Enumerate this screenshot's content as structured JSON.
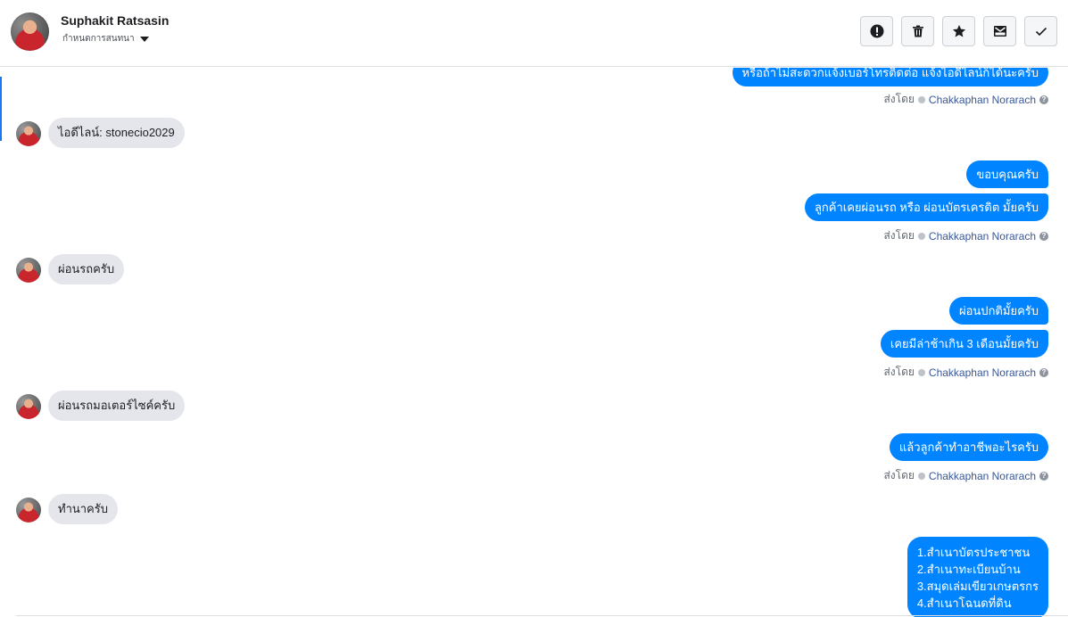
{
  "header": {
    "contact_name": "Suphakit Ratsasin",
    "contact_sub": "กำหนดการสนทนา",
    "actions": [
      "report-icon",
      "trash-icon",
      "star-icon",
      "mail-icon",
      "check-icon"
    ]
  },
  "thread": {
    "msg_top": "หรือถ้าไม่สะดวกแจ้งเบอร์โทรติดต่อ แจ้งไอดีไลน์ก็ได้นะครับ",
    "sent_by_label": "ส่งโดย",
    "agent_name": "Chakkaphan Norarach",
    "in1": "ไอดีไลน์: stonecio2029",
    "out2a": "ขอบคุณครับ",
    "out2b": "ลูกค้าเคยผ่อนรถ หรือ ผ่อนบัตรเครดิต มั้ยครับ",
    "in2": "ผ่อนรถครับ",
    "out3a": "ผ่อนปกติมั้ยครับ",
    "out3b": "เคยมีล่าช้าเกิน 3 เดือนมั้ยครับ",
    "in3": "ผ่อนรถมอเตอร์ไซค์ครับ",
    "out4": "แล้วลูกค้าทำอาชีพอะไรครับ",
    "in4": "ทำนาครับ",
    "out5_lines": [
      "1.สำเนาบัตรประชาชน",
      "2.สำเนาทะเบียนบ้าน",
      "3.สมุดเล่มเขียวเกษตรกร",
      "4.สำเนาโฉนดที่ดิน"
    ]
  }
}
